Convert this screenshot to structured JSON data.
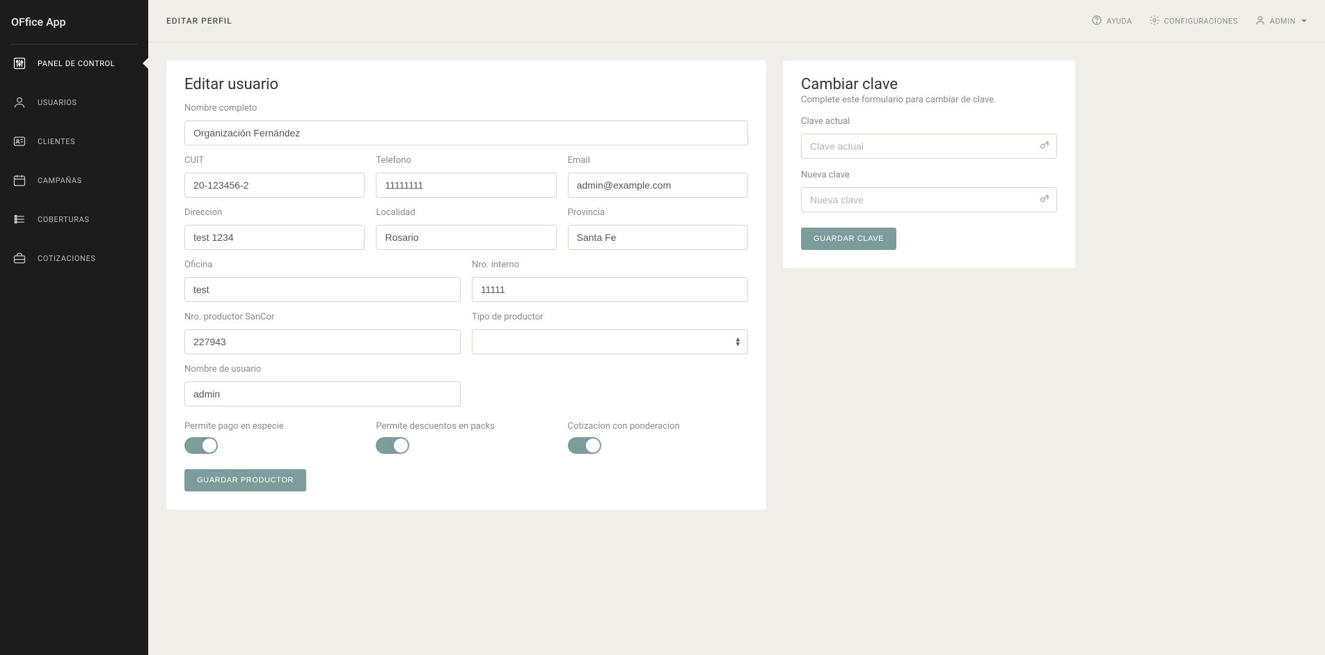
{
  "brand": "OFfice App",
  "sidebar": {
    "items": [
      {
        "label": "PANEL DE CONTROL",
        "name": "sidebar-item-dashboard",
        "icon": "sliders-icon",
        "active": true
      },
      {
        "label": "USUARIOS",
        "name": "sidebar-item-usuarios",
        "icon": "person-icon"
      },
      {
        "label": "CLIENTES",
        "name": "sidebar-item-clientes",
        "icon": "idcard-icon"
      },
      {
        "label": "CAMPAÑAS",
        "name": "sidebar-item-campanas",
        "icon": "calendar-icon"
      },
      {
        "label": "COBERTURAS",
        "name": "sidebar-item-coberturas",
        "icon": "list-icon"
      },
      {
        "label": "COTIZACIONES",
        "name": "sidebar-item-cotizaciones",
        "icon": "briefcase-icon"
      }
    ]
  },
  "topbar": {
    "page_title": "EDITAR PERFIL",
    "help_label": "AYUDA",
    "settings_label": "CONFIGURACIONES",
    "user_label": "ADMIN"
  },
  "edit": {
    "heading": "Editar usuario",
    "labels": {
      "nombre": "Nombre completo",
      "cuit": "CUIT",
      "telefono": "Telefono",
      "email": "Email",
      "direccion": "Direccion",
      "localidad": "Localidad",
      "provincia": "Provincia",
      "oficina": "Oficina",
      "nro_interno": "Nro. interno",
      "nro_productor": "Nro. productor SanCor",
      "tipo_productor": "Tipo de productor",
      "username": "Nombre de usuario",
      "pago_especie": "Permite pago en especie",
      "descuentos_packs": "Permite descuentos en packs",
      "cotizacion_ponderacion": "Cotizacion con ponderacion"
    },
    "values": {
      "nombre": "Organización Fernández",
      "cuit": "20-123456-2",
      "telefono": "11111111",
      "email": "admin@example.com",
      "direccion": "test 1234",
      "localidad": "Rosario",
      "provincia": "Santa Fe",
      "oficina": "test",
      "nro_interno": "11111",
      "nro_productor": "227943",
      "tipo_productor": "",
      "username": "admin"
    },
    "submit_label": "GUARDAR PRODUCTOR"
  },
  "password": {
    "heading": "Cambiar clave",
    "subtitle": "Complete este formulario para cambiar de clave.",
    "labels": {
      "current": "Clave actual",
      "new": "Nueva clave"
    },
    "placeholders": {
      "current": "Clave actual",
      "new": "Nueva clave"
    },
    "submit_label": "GUARDAR CLAVE"
  }
}
